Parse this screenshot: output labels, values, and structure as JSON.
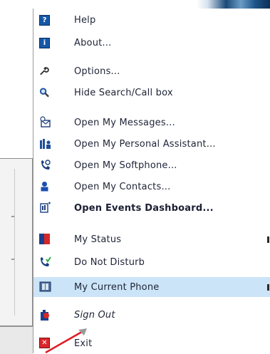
{
  "menu": {
    "items": [
      {
        "label": "Help"
      },
      {
        "label": "About..."
      },
      {
        "label": "Options..."
      },
      {
        "label": "Hide Search/Call box"
      },
      {
        "label": "Open My Messages..."
      },
      {
        "label": "Open My Personal Assistant..."
      },
      {
        "label": "Open My Softphone..."
      },
      {
        "label": "Open My Contacts..."
      },
      {
        "label": "Open Events Dashboard..."
      },
      {
        "label": "My Status"
      },
      {
        "label": "Do Not Disturb"
      },
      {
        "label": "My Current Phone"
      },
      {
        "label": "Sign Out"
      },
      {
        "label": "Exit"
      }
    ]
  },
  "icons": {
    "help": "question-icon",
    "about": "info-icon",
    "options": "wrench-icon",
    "search": "magnifier-icon",
    "messages": "envelope-icon",
    "assistant": "assistant-icon",
    "softphone": "phone-icon",
    "contacts": "person-icon",
    "events": "events-icon",
    "status": "status-icon",
    "dnd": "dnd-phone-icon",
    "phone": "current-phone-icon",
    "signout": "signout-icon",
    "exit": "exit-icon"
  },
  "colors": {
    "highlight": "#cce4f7",
    "text": "#1e2436",
    "icon_blue": "#1558a8",
    "exit_red": "#d8262a"
  }
}
